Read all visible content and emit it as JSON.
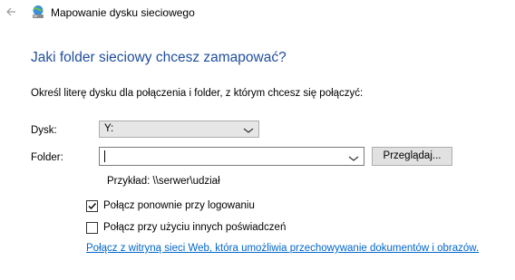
{
  "window": {
    "back_icon": "back-arrow-icon",
    "app_icon": "network-drive-icon",
    "title": "Mapowanie dysku sieciowego"
  },
  "main": {
    "heading": "Jaki folder sieciowy chcesz zamapować?",
    "instruction": "Określ literę dysku dla połączenia i folder, z którym chcesz się połączyć:"
  },
  "form": {
    "drive_label": "Dysk:",
    "drive_value": "Y:",
    "folder_label": "Folder:",
    "folder_value": "",
    "browse_label": "Przeglądaj...",
    "example": "Przykład: \\\\serwer\\udział"
  },
  "options": {
    "reconnect_label": "Połącz ponownie przy logowaniu",
    "reconnect_checked": true,
    "other_credentials_label": "Połącz przy użyciu innych poświadczeń",
    "other_credentials_checked": false
  },
  "link": {
    "text": "Połącz z witryną sieci Web, która umożliwia przechowywanie dokumentów i obrazów."
  },
  "colors": {
    "heading": "#1f4e9c",
    "link": "#0066cc"
  }
}
